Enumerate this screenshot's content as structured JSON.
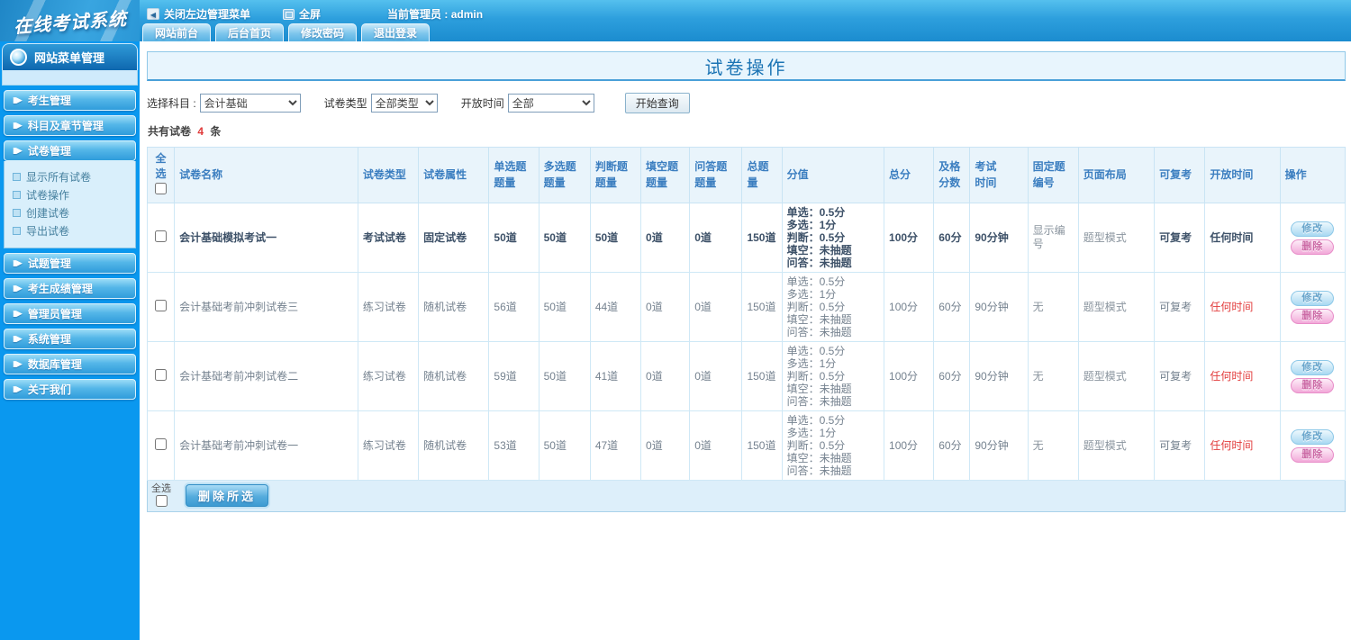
{
  "topbar": {
    "logo": "在线考试系统",
    "close_menu_label": "关闭左边管理菜单",
    "fullscreen_label": "全屏",
    "admin_label": "当前管理员 : admin",
    "tabs": [
      "网站前台",
      "后台首页",
      "修改密码",
      "退出登录"
    ]
  },
  "icons": {
    "close_menu": "◀",
    "menu_arrow": "▮▶"
  },
  "colors": {
    "topbar_blue": "#2d9fdd",
    "sidebar_blue": "#0a98ef",
    "title_text": "#1b74b4",
    "header_text": "#3b7ec0",
    "alert_red": "#e23c3c",
    "edit_pill": "#a9d9f2",
    "delete_pill": "#f2a9d9"
  },
  "sidebar": {
    "header": "网站菜单管理",
    "items": [
      {
        "label": "考生管理"
      },
      {
        "label": "科目及章节管理"
      },
      {
        "label": "试卷管理",
        "children": [
          "显示所有试卷",
          "试卷操作",
          "创建试卷",
          "导出试卷"
        ]
      },
      {
        "label": "试题管理"
      },
      {
        "label": "考生成绩管理"
      },
      {
        "label": "管理员管理"
      },
      {
        "label": "系统管理"
      },
      {
        "label": "数据库管理"
      },
      {
        "label": "关于我们"
      }
    ]
  },
  "main": {
    "title": "试卷操作",
    "filters": {
      "subject_label": "选择科目 :",
      "subject_value": "会计基础",
      "type_label": "试卷类型",
      "type_value": "全部类型",
      "time_label": "开放时间",
      "time_value": "全部",
      "query_button": "开始查询"
    },
    "summary": {
      "prefix": "共有试卷",
      "count": "4",
      "suffix": "条"
    },
    "table": {
      "headers": [
        "全选",
        "试卷名称",
        "试卷类型",
        "试卷属性",
        "单选题\n题量",
        "多选题\n题量",
        "判断题\n题量",
        "填空题\n题量",
        "问答题\n题量",
        "总题量",
        "分值",
        "总分",
        "及格\n分数",
        "考试\n时间",
        "固定题\n编号",
        "页面布局",
        "可复考",
        "开放时间",
        "操作"
      ],
      "actions": {
        "edit": "修改",
        "delete": "删除"
      },
      "rows": [
        {
          "bold": true,
          "name": "会计基础模拟考试一",
          "type": "考试试卷",
          "attr": "固定试卷",
          "single": "50道",
          "multi": "50道",
          "judge": "50道",
          "blank": "0道",
          "qa": "0道",
          "total": "150道",
          "scores": [
            "单选：0.5分",
            "多选：1分",
            "判断：0.5分",
            "填空：未抽题",
            "问答：未抽题"
          ],
          "total_score": "100分",
          "pass_score": "60分",
          "duration": "90分钟",
          "fixed_no": "显示编号",
          "layout": "题型模式",
          "retake": "可复考",
          "open_time": "任何时间"
        },
        {
          "bold": false,
          "name": "会计基础考前冲刺试卷三",
          "type": "练习试卷",
          "attr": "随机试卷",
          "single": "56道",
          "multi": "50道",
          "judge": "44道",
          "blank": "0道",
          "qa": "0道",
          "total": "150道",
          "scores": [
            "单选：0.5分",
            "多选：1分",
            "判断：0.5分",
            "填空：未抽题",
            "问答：未抽题"
          ],
          "total_score": "100分",
          "pass_score": "60分",
          "duration": "90分钟",
          "fixed_no": "无",
          "layout": "题型模式",
          "retake": "可复考",
          "open_time": "任何时间"
        },
        {
          "bold": false,
          "name": "会计基础考前冲刺试卷二",
          "type": "练习试卷",
          "attr": "随机试卷",
          "single": "59道",
          "multi": "50道",
          "judge": "41道",
          "blank": "0道",
          "qa": "0道",
          "total": "150道",
          "scores": [
            "单选：0.5分",
            "多选：1分",
            "判断：0.5分",
            "填空：未抽题",
            "问答：未抽题"
          ],
          "total_score": "100分",
          "pass_score": "60分",
          "duration": "90分钟",
          "fixed_no": "无",
          "layout": "题型模式",
          "retake": "可复考",
          "open_time": "任何时间"
        },
        {
          "bold": false,
          "name": "会计基础考前冲刺试卷一",
          "type": "练习试卷",
          "attr": "随机试卷",
          "single": "53道",
          "multi": "50道",
          "judge": "47道",
          "blank": "0道",
          "qa": "0道",
          "total": "150道",
          "scores": [
            "单选：0.5分",
            "多选：1分",
            "判断：0.5分",
            "填空：未抽题",
            "问答：未抽题"
          ],
          "total_score": "100分",
          "pass_score": "60分",
          "duration": "90分钟",
          "fixed_no": "无",
          "layout": "题型模式",
          "retake": "可复考",
          "open_time": "任何时间"
        }
      ]
    },
    "footer": {
      "select_all": "全选",
      "delete_selected": "删除所选"
    }
  }
}
